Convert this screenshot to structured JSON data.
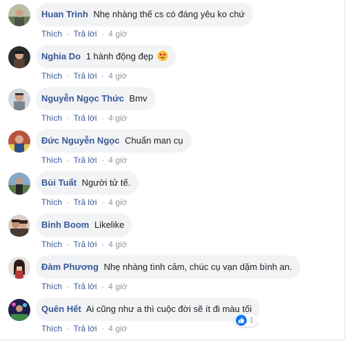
{
  "actions": {
    "like_label": "Thích",
    "reply_label": "Trả lời",
    "separator": "·"
  },
  "comments": [
    {
      "author": "Huan Trinh",
      "text": "Nhẹ nhàng thế cs có đáng yêu ko chứ",
      "time": "4 giờ",
      "avatar_color": "#8a9a7a"
    },
    {
      "author": "Nghia Do",
      "text": "1 hành động đẹp",
      "emoji": "heart-eyes-emoji",
      "time": "4 giờ",
      "avatar_color": "#3b3a3a"
    },
    {
      "author": "Nguyễn Ngọc Thức",
      "text": "Bmv",
      "time": "4 giờ",
      "avatar_color": "#9aa3ad"
    },
    {
      "author": "Đức Nguyễn Ngọc",
      "text": "Chuẩn man cụ",
      "time": "4 giờ",
      "avatar_color": "#a0503a"
    },
    {
      "author": "Bùi Tuất",
      "text": "Người tử tế.",
      "time": "4 giờ",
      "avatar_color": "#5a7a9a"
    },
    {
      "author": "Binh Boom",
      "text": "Likelike",
      "time": "4 giờ",
      "avatar_color": "#6a5a50"
    },
    {
      "author": "Đàm Phương",
      "text": "Nhẹ nhàng tình cảm, chúc cụ vạn dặm bình an.",
      "time": "4 giờ",
      "avatar_color": "#c8b8b0"
    },
    {
      "author": "Quên Hết",
      "text": "Ai cũng như a thì cuộc đời sẽ ít đi màu tối",
      "time": "4 giờ",
      "avatar_color": "#2a2a5a",
      "reaction": {
        "icon": "like-icon",
        "count": "1"
      }
    }
  ],
  "colors": {
    "author_link": "#385898",
    "bubble_bg": "#f2f3f5",
    "meta_gray": "#90949c",
    "like_blue": "#1877f2"
  }
}
